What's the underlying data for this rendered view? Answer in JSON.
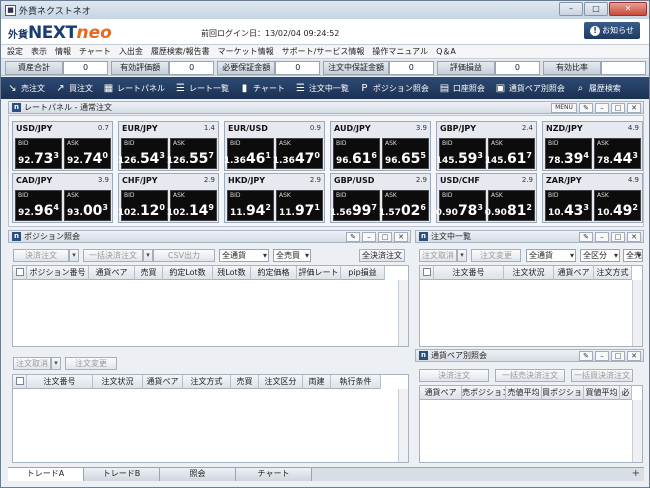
{
  "window": {
    "title": "外貨ネクストネオ",
    "minimize": "–",
    "maximize": "□",
    "close": "✕"
  },
  "brand": {
    "logo_prefix": "外貨",
    "logo_main": "NEXT",
    "logo_neo": "neo",
    "last_login": "前回ログイン日：13/02/04 09:24:52",
    "notice_label": "お知らせ",
    "notice_icon": "!"
  },
  "menu": [
    "設定",
    "表示",
    "情報",
    "チャート",
    "入出金",
    "履歴検索/報告書",
    "マーケット情報",
    "サポート/サービス情報",
    "操作マニュアル",
    "Q＆A"
  ],
  "summary": [
    {
      "label": "資産合計",
      "value": "0"
    },
    {
      "label": "有効評価額",
      "value": "0"
    },
    {
      "label": "必要保証金額",
      "value": "0"
    },
    {
      "label": "注文中保証金額",
      "value": "0"
    },
    {
      "label": "評価損益",
      "value": "0"
    },
    {
      "label": "有効比率",
      "value": ""
    }
  ],
  "toolbar": [
    {
      "icon": "sell-order-icon",
      "glyph": "↘",
      "label": "売注文"
    },
    {
      "icon": "buy-order-icon",
      "glyph": "↗",
      "label": "買注文"
    },
    {
      "icon": "rate-panel-icon",
      "glyph": "▦",
      "label": "レートパネル"
    },
    {
      "icon": "rate-list-icon",
      "glyph": "☰",
      "label": "レート一覧"
    },
    {
      "icon": "chart-icon",
      "glyph": "▮",
      "label": "チャート"
    },
    {
      "icon": "open-orders-icon",
      "glyph": "☰",
      "label": "注文中一覧"
    },
    {
      "icon": "position-icon",
      "glyph": "P",
      "label": "ポジション照会"
    },
    {
      "icon": "account-icon",
      "glyph": "▤",
      "label": "口座照会"
    },
    {
      "icon": "pair-icon",
      "glyph": "▣",
      "label": "通貨ペア別照会"
    },
    {
      "icon": "history-search-icon",
      "glyph": "⌕",
      "label": "履歴検索"
    }
  ],
  "rate_panel": {
    "title": "レートパネル - 通常注文",
    "menu_label": "MENU",
    "bid_label": "BID",
    "ask_label": "ASK",
    "cards": [
      {
        "pair": "USD/JPY",
        "spread": "0.7",
        "bid": [
          "",
          "92.",
          "73",
          "3"
        ],
        "ask": [
          "",
          "92.",
          "74",
          "0"
        ]
      },
      {
        "pair": "EUR/JPY",
        "spread": "1.4",
        "bid": [
          "",
          "126.",
          "54",
          "3"
        ],
        "ask": [
          "",
          "126.",
          "55",
          "7"
        ]
      },
      {
        "pair": "EUR/USD",
        "spread": "0.9",
        "bid": [
          "1.36",
          "",
          "46",
          "1"
        ],
        "ask": [
          "1.36",
          "",
          "47",
          "0"
        ]
      },
      {
        "pair": "AUD/JPY",
        "spread": "3.9",
        "bid": [
          "",
          "96.",
          "61",
          "6"
        ],
        "ask": [
          "",
          "96.",
          "65",
          "5"
        ]
      },
      {
        "pair": "GBP/JPY",
        "spread": "2.4",
        "bid": [
          "",
          "145.",
          "59",
          "3"
        ],
        "ask": [
          "",
          "145.",
          "61",
          "7"
        ]
      },
      {
        "pair": "NZD/JPY",
        "spread": "4.9",
        "bid": [
          "",
          "78.",
          "39",
          "4"
        ],
        "ask": [
          "",
          "78.",
          "44",
          "3"
        ]
      },
      {
        "pair": "CAD/JPY",
        "spread": "3.9",
        "bid": [
          "",
          "92.",
          "96",
          "4"
        ],
        "ask": [
          "",
          "93.",
          "00",
          "3"
        ]
      },
      {
        "pair": "CHF/JPY",
        "spread": "2.9",
        "bid": [
          "",
          "102.",
          "12",
          "0"
        ],
        "ask": [
          "",
          "102.",
          "14",
          "9"
        ]
      },
      {
        "pair": "HKD/JPY",
        "spread": "2.9",
        "bid": [
          "",
          "11.",
          "94",
          "2"
        ],
        "ask": [
          "",
          "11.",
          "97",
          "1"
        ]
      },
      {
        "pair": "GBP/USD",
        "spread": "2.9",
        "bid": [
          "1.56",
          "",
          "99",
          "7"
        ],
        "ask": [
          "1.57",
          "",
          "02",
          "6"
        ]
      },
      {
        "pair": "USD/CHF",
        "spread": "2.9",
        "bid": [
          "0.90",
          "",
          "78",
          "3"
        ],
        "ask": [
          "0.90",
          "",
          "81",
          "2"
        ]
      },
      {
        "pair": "ZAR/JPY",
        "spread": "4.9",
        "bid": [
          "",
          "10.",
          "43",
          "3"
        ],
        "ask": [
          "",
          "10.",
          "49",
          "2"
        ]
      }
    ]
  },
  "position_panel": {
    "title": "ポジション照会",
    "btn_settle": "決済注文",
    "btn_bulk_settle": "一括決済注文",
    "btn_csv": "CSV出力",
    "sel_currency": "全通貨",
    "sel_side": "全売買",
    "btn_settle_all": "全決済注文",
    "columns": [
      "",
      "ポジション番号",
      "通貨ペア",
      "売買",
      "約定Lot数",
      "残Lot数",
      "約定価格",
      "評価レート",
      "pip損益"
    ]
  },
  "order_sub": {
    "btn_cancel": "注文取消",
    "btn_change": "注文変更",
    "columns": [
      "",
      "注文番号",
      "注文状況",
      "通貨ペア",
      "注文方式",
      "売買",
      "注文区分",
      "両建",
      "執行条件"
    ]
  },
  "open_orders_panel": {
    "title": "注文中一覧",
    "btn_cancel": "注文取消",
    "btn_change": "注文変更",
    "sel_currency": "全通貨",
    "sel_type": "全区分",
    "sel_side": "全売買",
    "columns": [
      "",
      "注文番号",
      "注文状況",
      "通貨ペア",
      "注文方式"
    ]
  },
  "pair_panel": {
    "title": "通貨ペア別照会",
    "btn_settle": "決済注文",
    "btn_bulk_sell": "一括売決済注文",
    "btn_bulk_buy": "一括買決済注文",
    "columns": [
      "通貨ペア",
      "売ポジション",
      "売値平均",
      "買ポジション",
      "買値平均",
      "必"
    ]
  },
  "tabs": [
    "トレードA",
    "トレードB",
    "照会",
    "チャート"
  ],
  "tab_add": "+"
}
